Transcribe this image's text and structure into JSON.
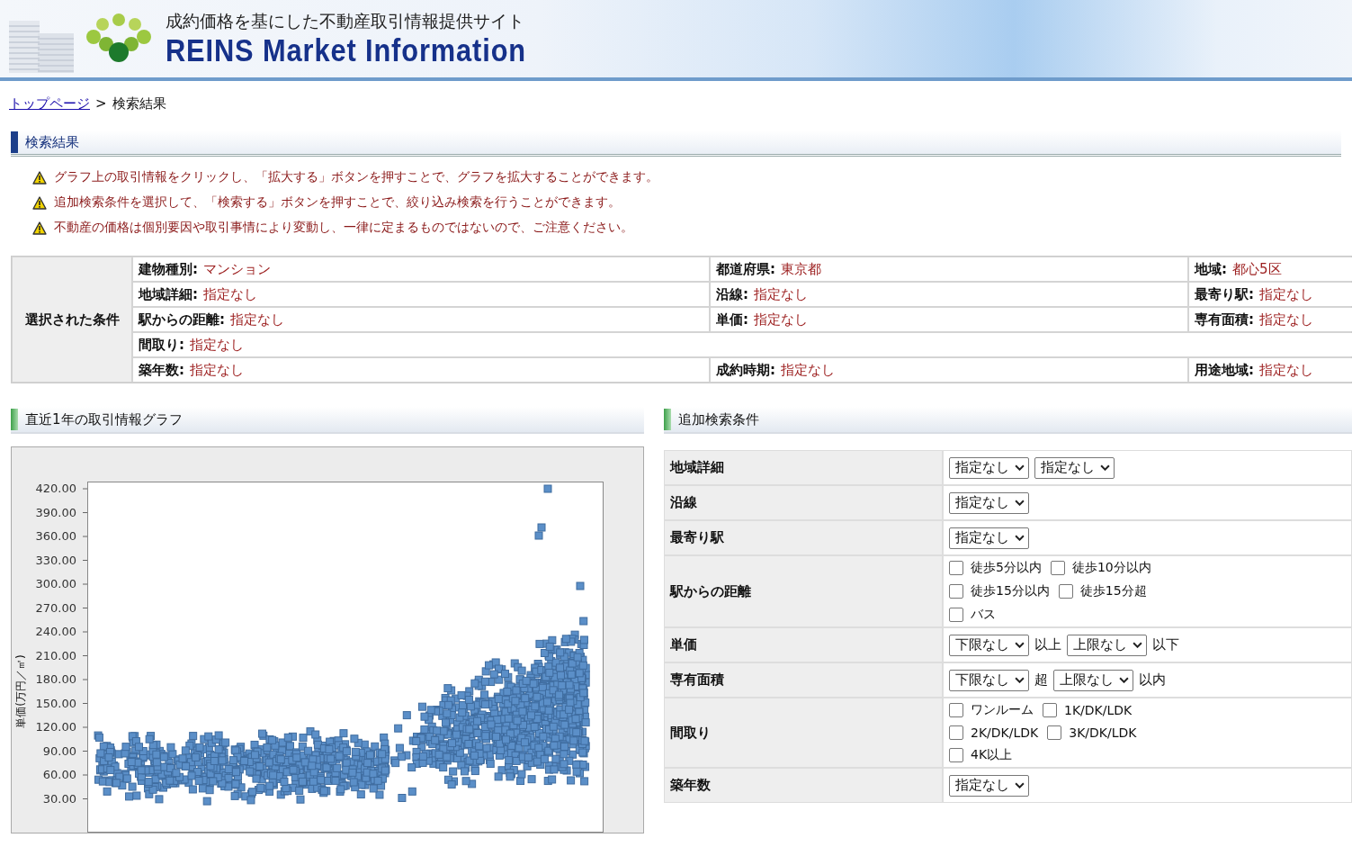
{
  "header": {
    "subtitle": "成約価格を基にした不動産取引情報提供サイト",
    "title": "REINS Market Information"
  },
  "breadcrumb": {
    "link": "トップページ",
    "separator": ">",
    "current": "検索結果"
  },
  "page_heading": "検索結果",
  "notes": [
    "グラフ上の取引情報をクリックし、「拡大する」ボタンを押すことで、グラフを拡大することができます。",
    "追加検索条件を選択して、「検索する」ボタンを押すことで、絞り込み検索を行うことができます。",
    "不動産の価格は個別要因や取引事情により変動し、一律に定まるものではないので、ご注意ください。"
  ],
  "conditions": {
    "header": "選択された条件",
    "rows": [
      [
        {
          "label": "建物種別:",
          "value": "マンション"
        },
        {
          "label": "都道府県:",
          "value": "東京都"
        },
        {
          "label": "地域:",
          "value": "都心5区"
        }
      ],
      [
        {
          "label": "地域詳細:",
          "value": "指定なし"
        },
        {
          "label": "沿線:",
          "value": "指定なし"
        },
        {
          "label": "最寄り駅:",
          "value": "指定なし"
        }
      ],
      [
        {
          "label": "駅からの距離:",
          "value": "指定なし"
        },
        {
          "label": "単価:",
          "value": "指定なし"
        },
        {
          "label": "専有面積:",
          "value": "指定なし"
        }
      ],
      [
        {
          "label": "間取り:",
          "value": "指定なし"
        }
      ],
      [
        {
          "label": "築年数:",
          "value": "指定なし"
        },
        {
          "label": "成約時期:",
          "value": "指定なし"
        },
        {
          "label": "用途地域:",
          "value": "指定なし"
        }
      ]
    ]
  },
  "graph": {
    "heading": "直近1年の取引情報グラフ",
    "ylabel": "単価(万円／㎡)",
    "yticks": [
      "420.00",
      "390.00",
      "360.00",
      "330.00",
      "300.00",
      "270.00",
      "240.00",
      "210.00",
      "180.00",
      "150.00",
      "120.00",
      "90.00",
      "60.00",
      "30.00"
    ]
  },
  "search": {
    "heading": "追加検索条件",
    "rows": [
      {
        "label": "地域詳細",
        "items": [
          {
            "kind": "select",
            "value": "指定なし"
          },
          {
            "kind": "select",
            "value": "指定なし"
          }
        ]
      },
      {
        "label": "沿線",
        "items": [
          {
            "kind": "select",
            "value": "指定なし"
          }
        ]
      },
      {
        "label": "最寄り駅",
        "items": [
          {
            "kind": "select",
            "value": "指定なし"
          }
        ]
      },
      {
        "label": "駅からの距離",
        "items": [
          {
            "kind": "checkbox",
            "label": "徒歩5分以内",
            "checked": false
          },
          {
            "kind": "checkbox",
            "label": "徒歩10分以内",
            "checked": false
          },
          {
            "kind": "break"
          },
          {
            "kind": "checkbox",
            "label": "徒歩15分以内",
            "checked": false
          },
          {
            "kind": "checkbox",
            "label": "徒歩15分超",
            "checked": false
          },
          {
            "kind": "break"
          },
          {
            "kind": "checkbox",
            "label": "バス",
            "checked": false
          }
        ]
      },
      {
        "label": "単価",
        "items": [
          {
            "kind": "select",
            "value": "下限なし"
          },
          {
            "kind": "text",
            "text": "以上"
          },
          {
            "kind": "select",
            "value": "上限なし"
          },
          {
            "kind": "text",
            "text": "以下"
          }
        ]
      },
      {
        "label": "専有面積",
        "items": [
          {
            "kind": "select",
            "value": "下限なし"
          },
          {
            "kind": "text",
            "text": "超"
          },
          {
            "kind": "select",
            "value": "上限なし"
          },
          {
            "kind": "text",
            "text": "以内"
          }
        ]
      },
      {
        "label": "間取り",
        "items": [
          {
            "kind": "checkbox",
            "label": "ワンルーム",
            "checked": false
          },
          {
            "kind": "checkbox",
            "label": "1K/DK/LDK",
            "checked": false
          },
          {
            "kind": "break"
          },
          {
            "kind": "checkbox",
            "label": "2K/DK/LDK",
            "checked": false
          },
          {
            "kind": "checkbox",
            "label": "3K/DK/LDK",
            "checked": false
          },
          {
            "kind": "break"
          },
          {
            "kind": "checkbox",
            "label": "4K以上",
            "checked": false
          }
        ]
      },
      {
        "label": "築年数",
        "items": [
          {
            "kind": "select",
            "value": "指定なし"
          }
        ]
      }
    ]
  }
}
